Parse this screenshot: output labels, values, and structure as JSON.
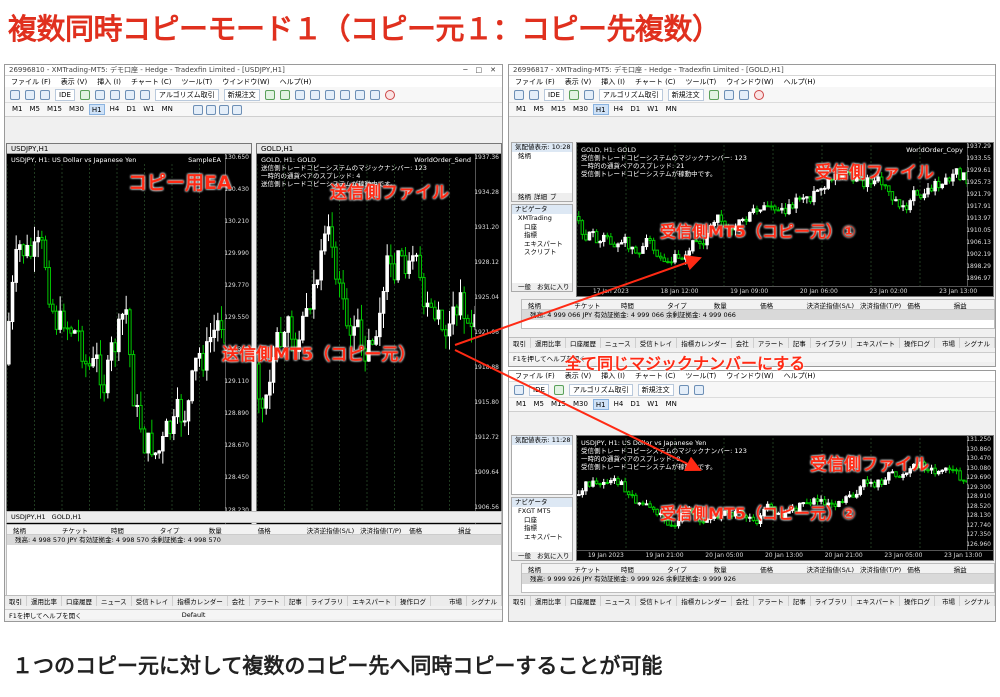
{
  "heading": "複数同時コピーモード１（コピー元１：コピー先複数）",
  "footer": "１つのコピー元に対して複数のコピー先へ同時コピーすることが可能",
  "colors": {
    "accent_red": "#ff2a14",
    "chart_bg": "#000000",
    "candle_bull": "#ffffff",
    "candle_bear": "#00c800"
  },
  "sender": {
    "title": "26996810 - XMTrading-MT5: デモ口座 - Hedge - Tradexfin Limited - [USDJPY,H1]",
    "menu": [
      "ファイル (F)",
      "表示 (V)",
      "挿入 (I)",
      "チャート (C)",
      "ツール(T)",
      "ウインドウ(W)",
      "ヘルプ(H)"
    ],
    "algo_label": "アルゴリズム取引",
    "new_order": "新規注文",
    "ide": "IDE",
    "timeframes": [
      "M1",
      "M5",
      "M15",
      "M30",
      "H1",
      "H4",
      "D1",
      "W1",
      "MN"
    ],
    "active_tf": "H1",
    "chart_usdjpy": {
      "tab": "USDJPY,H1",
      "info": "USDJPY, H1:  US Dollar vs Japanese Yen",
      "ea": "SampleEA",
      "prices": [
        "130.650",
        "130.540",
        "130.430",
        "130.320",
        "130.210",
        "130.100",
        "129.990",
        "129.880",
        "129.770",
        "129.660",
        "129.550",
        "129.440",
        "129.330",
        "129.220",
        "129.110",
        "129.000",
        "128.890",
        "128.780",
        "128.670",
        "128.560",
        "128.450",
        "128.340",
        "128.230",
        "128.120",
        "128.010",
        "127.900"
      ],
      "times": [
        "19 Jan 2023",
        "20 Jan 01:00",
        "20 Jan 09:00",
        "20 Jan 17:00",
        "23 Jan 02:00",
        "23 Jan 10:00"
      ]
    },
    "chart_gold": {
      "tab": "GOLD,H1",
      "info": "GOLD, H1:  GOLD",
      "ea": "WorldOrder_Send",
      "lines": [
        "送信側トレードコピーシステムのマジックナンバー: 123",
        "一時的の通貨ペアのスプレッド: 4",
        "送信側トレードコピーシステムが稼動中です。"
      ],
      "prices": [
        "1937.36",
        "1934.28",
        "1931.20",
        "1928.12",
        "1925.04",
        "1921.96",
        "1918.88",
        "1915.80",
        "1912.72",
        "1909.64",
        "1906.56",
        "1903.48"
      ],
      "times": [
        "19 Jan 2023",
        "20 Jan 02:00",
        "20 Jan 10:00",
        "20 Jan 18:00",
        "23 Jan 03:00"
      ]
    },
    "tabs": [
      "USDJPY,H1",
      "GOLD,H1"
    ],
    "columns": [
      "銘柄",
      "チケット",
      "時間",
      "タイプ",
      "数量",
      "価格",
      "決済逆指値(S/L)",
      "決済指値(T/P)",
      "価格",
      "損益"
    ],
    "balance": "残高: 4 998 570 JPY  有効証拠金: 4 998 570  余剰証拠金: 4 998 570",
    "bottom_tabs": [
      "取引",
      "運用比率",
      "口座履歴",
      "ニュース",
      "受信トレイ",
      "指標カレンダー",
      "会社",
      "アラート",
      "記事",
      "ライブラリ",
      "エキスパート",
      "操作ログ"
    ],
    "market": "市場",
    "signal": "シグナル",
    "status_help": "F1を押してヘルプを開く",
    "status_default": "Default"
  },
  "receiver1": {
    "title": "26996817 - XMTrading-MT5: デモ口座 - Hedge - Tradexfin Limited - [GOLD,H1]",
    "market_watch": "気配値表示: 10:28",
    "nav_title": "ナビゲータ",
    "nav_items": [
      "XMTrading",
      "口座",
      "指標",
      "エキスパート",
      "スクリプト"
    ],
    "nav_tabs": [
      "一般",
      "お気に入り"
    ],
    "watch_tabs": [
      "銘柄",
      "詳細",
      "ブ"
    ],
    "chart_info": "GOLD, H1:  GOLD",
    "ea": "WorldOrder_Copy",
    "lines": [
      "受信側トレードコピーシステムのマジックナンバー: 123",
      "一時的の通貨ペアのスプレッド: 21",
      "受信側トレードコピーシステムが稼動中です。"
    ],
    "prices": [
      "1937.29",
      "1933.55",
      "1929.61",
      "1925.73",
      "1921.79",
      "1917.91",
      "1913.97",
      "1910.05",
      "1906.13",
      "1902.19",
      "1898.29",
      "1896.97"
    ],
    "times": [
      "17 Jan 2023",
      "18 Jan 12:00",
      "19 Jan 09:00",
      "20 Jan 06:00",
      "23 Jan 02:00",
      "23 Jan 13:00"
    ],
    "balance": "残高: 4 999 066 JPY  有効証拠金: 4 999 066  余剰証拠金: 4 999 066",
    "status_help": "F1を押してヘルプを開く",
    "market": "市場",
    "signal": "シグナル"
  },
  "receiver2": {
    "title": "",
    "market_watch": "気配値表示: 11:28",
    "nav_title": "ナビゲータ",
    "nav_items": [
      "FXGT MT5",
      "口座",
      "指標",
      "エキスパート"
    ],
    "nav_tabs": [
      "一般",
      "お気に入り"
    ],
    "chart_info": "USDJPY, H1:  US Dollar vs Japanese Yen",
    "lines": [
      "受信側トレードコピーシステムのマジックナンバー: 123",
      "一時的の通貨ペアのスプレッド: 8",
      "受信側トレードコピーシステムが稼動中です。"
    ],
    "prices": [
      "131.250",
      "130.860",
      "130.470",
      "130.080",
      "129.690",
      "129.300",
      "128.910",
      "128.520",
      "128.130",
      "127.740",
      "127.350",
      "126.960"
    ],
    "times": [
      "19 Jan 2023",
      "19 Jan 21:00",
      "20 Jan 05:00",
      "20 Jan 13:00",
      "20 Jan 21:00",
      "23 Jan 05:00",
      "23 Jan 13:00"
    ],
    "balance": "残高: 9 999 926 JPY  有効証拠金: 9 999 926  余剰証拠金: 9 999 926",
    "market": "市場",
    "signal": "シグナル"
  },
  "annotations": {
    "copy_ea": "コピー用EA",
    "sender_file": "送信側ファイル",
    "sender_mt5": "送信側MT5（コピー元）",
    "receiver_file_1": "受信側ファイル",
    "receiver_mt5_1": "受信側MT5（コピー元）①",
    "magic": "全て同じマジックナンバーにする",
    "receiver_file_2": "受信側ファイル",
    "receiver_mt5_2": "受信側MT5（コピー元）②"
  }
}
